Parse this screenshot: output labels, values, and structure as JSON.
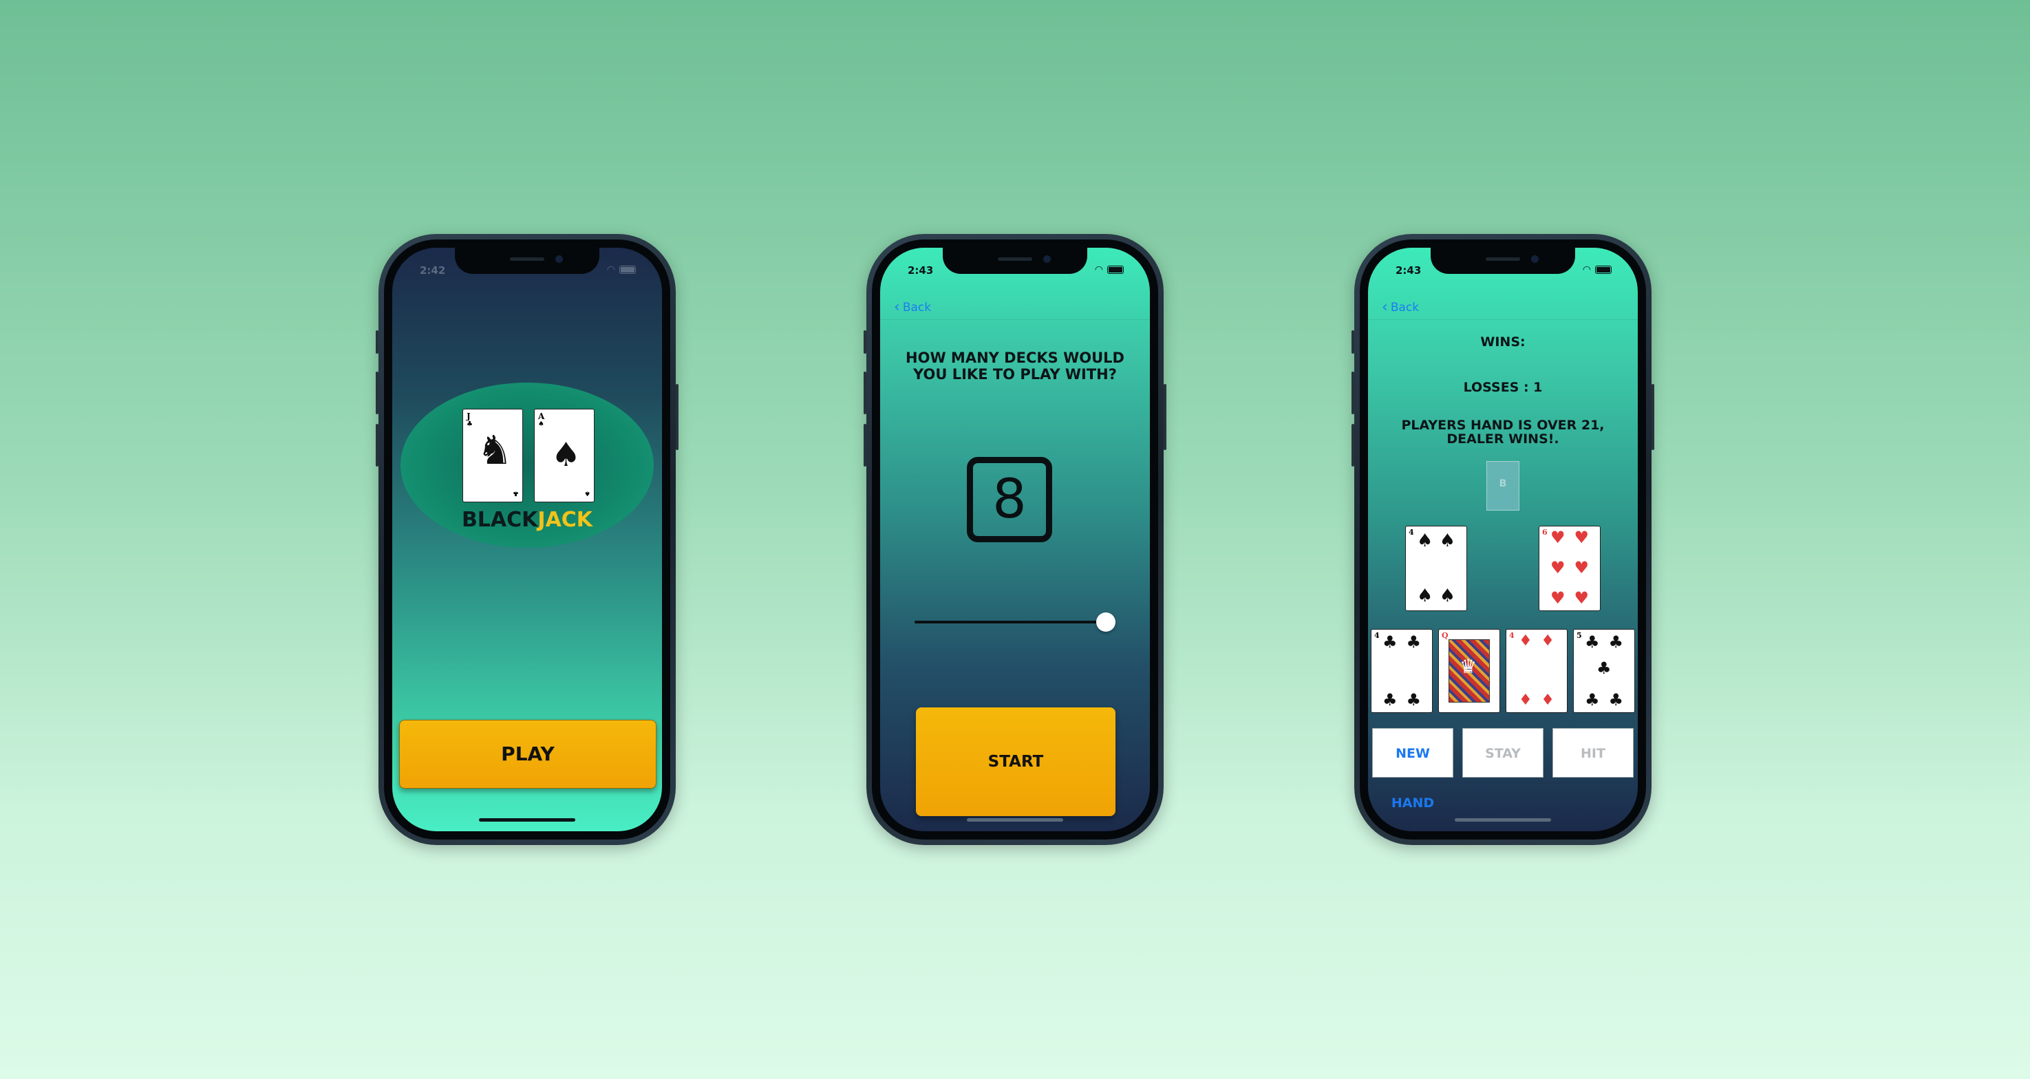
{
  "colors": {
    "accent_yellow": "#f2b20a",
    "back_link_blue": "#1d7cf2",
    "new_hand_blue": "#1b78f0",
    "disabled_gray": "#b8bcbf",
    "suit_red": "#e23b3b"
  },
  "screen1": {
    "status_time": "2:42",
    "logo": {
      "cards": [
        {
          "rank": "J",
          "suit": "♣"
        },
        {
          "rank": "A",
          "suit": "♠"
        }
      ],
      "word_black": "BLACK",
      "word_jack": "JACK"
    },
    "play_label": "PLAY"
  },
  "screen2": {
    "status_time": "2:43",
    "back_label": "Back",
    "question": "HOW MANY DECKS WOULD YOU LIKE TO PLAY WITH?",
    "deck_count": "8",
    "slider_level": 1.0,
    "start_label": "START"
  },
  "screen3": {
    "status_time": "2:43",
    "back_label": "Back",
    "wins_text": "WINS:",
    "losses_text": "LOSSES : 1",
    "result_text": "PLAYERS HAND IS OVER 21, DEALER WINS!.",
    "deck_card_glyph": "B",
    "upper_cards": [
      {
        "rank": "4",
        "suit": "♠"
      },
      {
        "rank": "6",
        "suit": "♥"
      }
    ],
    "lower_cards": [
      {
        "rank": "4",
        "suit": "♣"
      },
      {
        "rank": "Q",
        "suit": "♥"
      },
      {
        "rank": "4",
        "suit": "♦"
      },
      {
        "rank": "5",
        "suit": "♣"
      }
    ],
    "buttons": {
      "new_hand": "NEW HAND",
      "stay": "STAY",
      "hit": "HIT"
    }
  }
}
